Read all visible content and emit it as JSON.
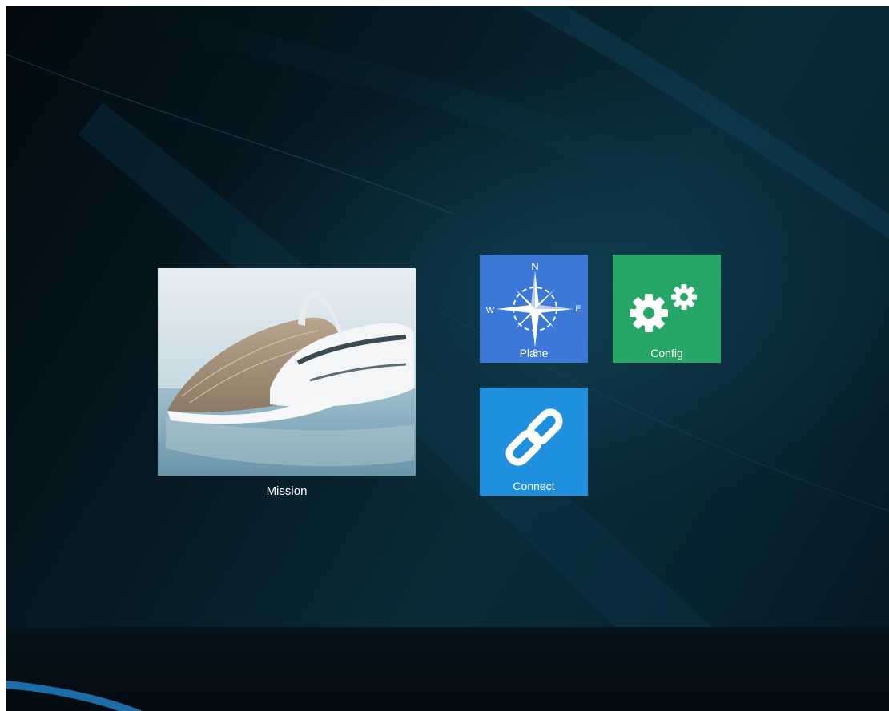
{
  "tiles": {
    "mission": {
      "label": "Mission",
      "image": "futuristic-yacht-image"
    },
    "plane": {
      "label": "Plane",
      "icon": "compass-rose-icon",
      "compass": {
        "n": "N",
        "s": "S",
        "e": "E",
        "w": "W"
      },
      "color": "#3b78d8"
    },
    "config": {
      "label": "Config",
      "icon": "gears-icon",
      "color": "#27a767"
    },
    "connect": {
      "label": "Connect",
      "icon": "chain-link-icon",
      "color": "#1e90de"
    }
  },
  "colors": {
    "background": "#06202b",
    "accent": "#1b5f7a"
  }
}
